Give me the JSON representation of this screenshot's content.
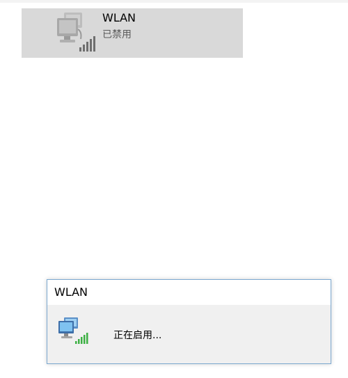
{
  "adapter": {
    "name": "WLAN",
    "status": "已禁用",
    "icon": "wireless-network-adapter-icon"
  },
  "dialog": {
    "title": "WLAN",
    "message": "正在启用...",
    "icon": "wireless-network-adapter-icon"
  },
  "colors": {
    "tile_selected": "#d9d9d9",
    "dialog_border": "#7aa7cf",
    "dialog_body": "#f0f0f0",
    "signal_green": "#3cb043"
  }
}
